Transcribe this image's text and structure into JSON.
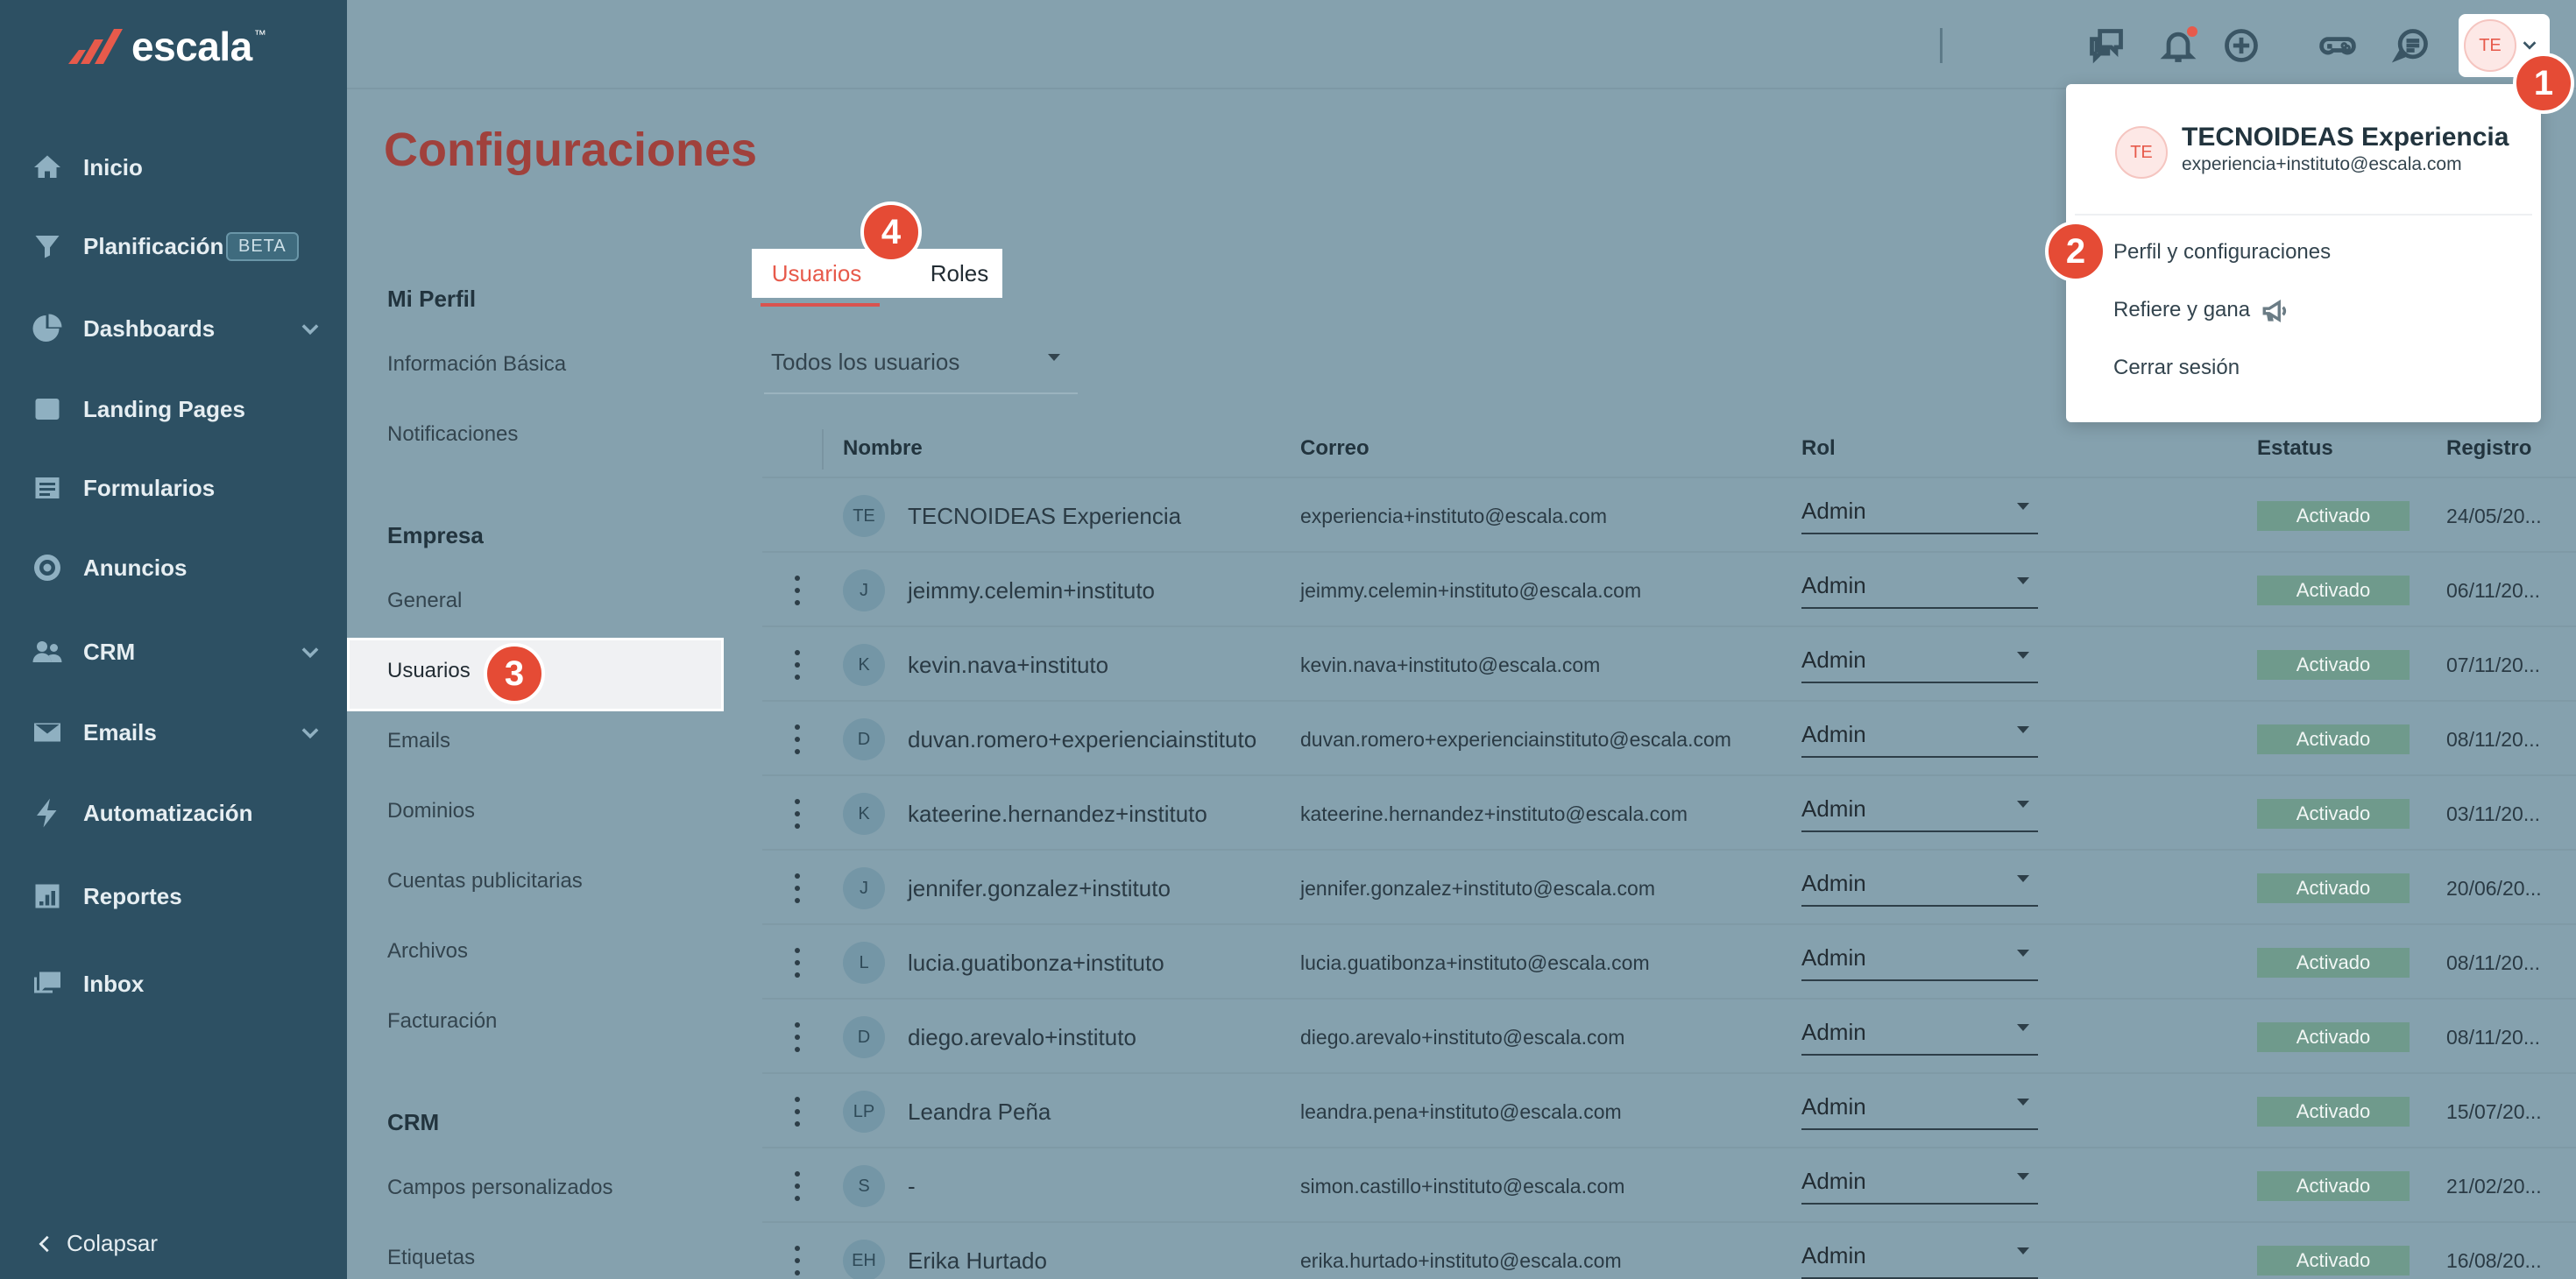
{
  "brand": {
    "name": "escala",
    "tm": "™"
  },
  "sidebar": {
    "items": [
      {
        "label": "Inicio",
        "icon": "home-icon"
      },
      {
        "label": "Planificación",
        "icon": "filter-icon",
        "badge": "BETA"
      },
      {
        "label": "Dashboards",
        "icon": "pie-chart-icon"
      },
      {
        "label": "Landing Pages",
        "icon": "page-icon"
      },
      {
        "label": "Formularios",
        "icon": "form-icon"
      },
      {
        "label": "Anuncios",
        "icon": "target-icon"
      },
      {
        "label": "CRM",
        "icon": "people-icon"
      },
      {
        "label": "Emails",
        "icon": "mail-icon"
      },
      {
        "label": "Automatización",
        "icon": "bolt-icon"
      },
      {
        "label": "Reportes",
        "icon": "report-icon"
      },
      {
        "label": "Inbox",
        "icon": "inbox-icon"
      }
    ],
    "collapse_label": "Colapsar"
  },
  "topbar": {
    "icons": [
      "chat-icon",
      "bell-icon",
      "plus-circle-icon",
      "gamepad-icon",
      "support-chat-icon"
    ],
    "avatar_initials": "TE"
  },
  "page": {
    "title": "Configuraciones"
  },
  "settings_menu": {
    "mi_perfil": {
      "title": "Mi Perfil",
      "items": [
        "Información Básica",
        "Notificaciones"
      ]
    },
    "empresa": {
      "title": "Empresa",
      "items": [
        "General",
        "Usuarios",
        "Emails",
        "Dominios",
        "Cuentas publicitarias",
        "Archivos",
        "Facturación"
      ]
    },
    "crm": {
      "title": "CRM",
      "items": [
        "Campos personalizados",
        "Etiquetas"
      ]
    }
  },
  "tabs": {
    "usuarios": "Usuarios",
    "roles": "Roles"
  },
  "filter": {
    "value": "Todos los usuarios"
  },
  "table": {
    "headers": {
      "nombre": "Nombre",
      "correo": "Correo",
      "rol": "Rol",
      "estatus": "Estatus",
      "registro": "Registro"
    },
    "rows": [
      {
        "initials": "TE",
        "name": "TECNOIDEAS Experiencia",
        "email": "experiencia+instituto@escala.com",
        "rol": "Admin",
        "status": "Activado",
        "registro": "24/05/20..."
      },
      {
        "initials": "J",
        "name": "jeimmy.celemin+instituto",
        "email": "jeimmy.celemin+instituto@escala.com",
        "rol": "Admin",
        "status": "Activado",
        "registro": "06/11/20..."
      },
      {
        "initials": "K",
        "name": "kevin.nava+instituto",
        "email": "kevin.nava+instituto@escala.com",
        "rol": "Admin",
        "status": "Activado",
        "registro": "07/11/20..."
      },
      {
        "initials": "D",
        "name": "duvan.romero+experienciainstituto",
        "email": "duvan.romero+experienciainstituto@escala.com",
        "rol": "Admin",
        "status": "Activado",
        "registro": "08/11/20..."
      },
      {
        "initials": "K",
        "name": "kateerine.hernandez+instituto",
        "email": "kateerine.hernandez+instituto@escala.com",
        "rol": "Admin",
        "status": "Activado",
        "registro": "03/11/20..."
      },
      {
        "initials": "J",
        "name": "jennifer.gonzalez+instituto",
        "email": "jennifer.gonzalez+instituto@escala.com",
        "rol": "Admin",
        "status": "Activado",
        "registro": "20/06/20..."
      },
      {
        "initials": "L",
        "name": "lucia.guatibonza+instituto",
        "email": "lucia.guatibonza+instituto@escala.com",
        "rol": "Admin",
        "status": "Activado",
        "registro": "08/11/20..."
      },
      {
        "initials": "D",
        "name": "diego.arevalo+instituto",
        "email": "diego.arevalo+instituto@escala.com",
        "rol": "Admin",
        "status": "Activado",
        "registro": "08/11/20..."
      },
      {
        "initials": "LP",
        "name": "Leandra Peña",
        "email": "leandra.pena+instituto@escala.com",
        "rol": "Admin",
        "status": "Activado",
        "registro": "15/07/20..."
      },
      {
        "initials": "S",
        "name": "-",
        "email": "simon.castillo+instituto@escala.com",
        "rol": "Admin",
        "status": "Activado",
        "registro": "21/02/20..."
      },
      {
        "initials": "EH",
        "name": "Erika Hurtado",
        "email": "erika.hurtado+instituto@escala.com",
        "rol": "Admin",
        "status": "Activado",
        "registro": "16/08/20..."
      }
    ]
  },
  "dropdown": {
    "initials": "TE",
    "name": "TECNOIDEAS Experiencia",
    "email": "experiencia+instituto@escala.com",
    "items": [
      "Perfil y configuraciones",
      "Refiere y gana",
      "Cerrar sesión"
    ]
  },
  "markers": [
    "1",
    "2",
    "3",
    "4"
  ],
  "colors": {
    "accent": "#e75a4b",
    "marker": "#e54b35",
    "sidebar": "#2d5063",
    "status": "#6f9a8c",
    "title": "#a0413c"
  }
}
